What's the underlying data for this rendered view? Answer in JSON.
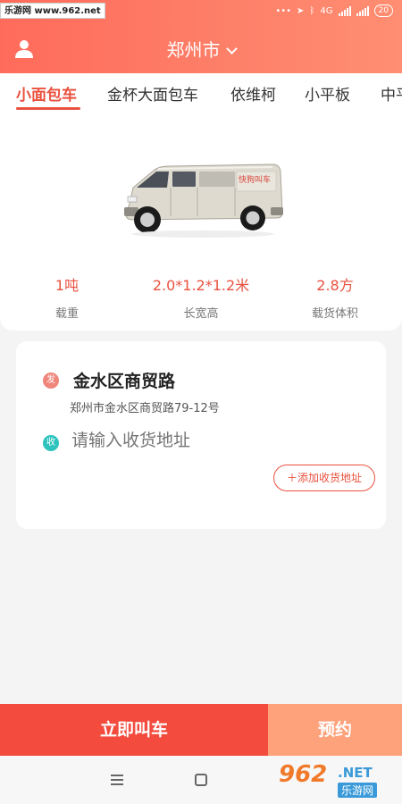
{
  "status_bar": {
    "watermark": "乐游网 www.962.net",
    "network": "4G",
    "battery": "20"
  },
  "header": {
    "city": "郑州市"
  },
  "tabs": [
    {
      "label": "小面包车",
      "active": true
    },
    {
      "label": "金杯大面包车",
      "active": false
    },
    {
      "label": "依维柯",
      "active": false
    },
    {
      "label": "小平板",
      "active": false
    },
    {
      "label": "中平",
      "active": false
    }
  ],
  "vehicle": {
    "image_name": "van-image",
    "specs": [
      {
        "value": "1吨",
        "label": "载重"
      },
      {
        "value": "2.0*1.2*1.2米",
        "label": "长宽高"
      },
      {
        "value": "2.8方",
        "label": "载货体积"
      }
    ]
  },
  "address": {
    "send_badge": "发",
    "send_title": "金水区商贸路",
    "send_detail": "郑州市金水区商贸路79-12号",
    "recv_badge": "收",
    "recv_placeholder": "请输入收货地址",
    "add_button": "＋添加收货地址"
  },
  "actions": {
    "call_now": "立即叫车",
    "reserve": "预约"
  },
  "watermark": {
    "num": "962",
    "net": ".NET",
    "cn": "乐游网"
  },
  "colors": {
    "accent": "#e9513f",
    "header_gradient_start": "#ff6b5a",
    "call_button": "#f34b3e",
    "reserve_button": "#fea27b",
    "receive_dot": "#2fc3be"
  }
}
